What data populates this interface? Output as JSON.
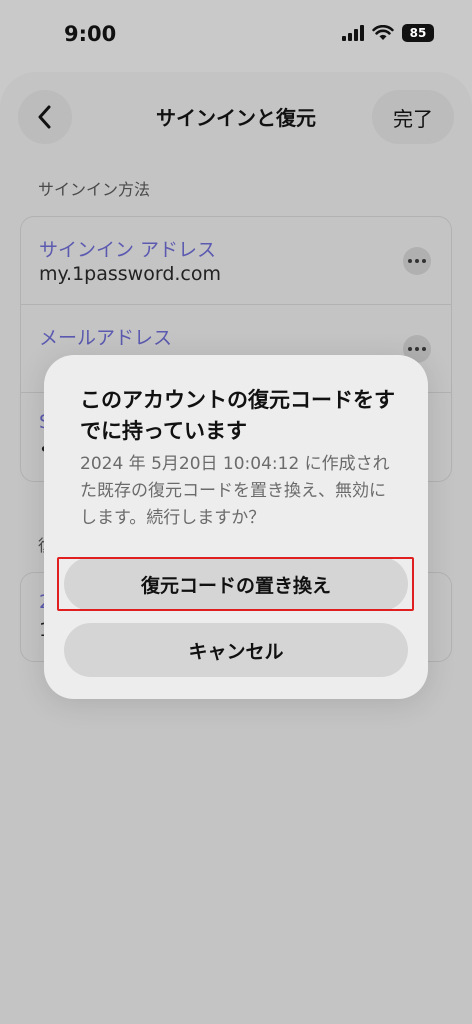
{
  "status_bar": {
    "time": "9:00",
    "battery": "85"
  },
  "nav": {
    "title": "サインインと復元",
    "done_label": "完了"
  },
  "section_signin": {
    "label": "サインイン方法",
    "rows": [
      {
        "label": "サインイン アドレス",
        "value": "my.1password.com"
      },
      {
        "label": "メールアドレス",
        "value": ""
      },
      {
        "label": "S",
        "value": "•"
      }
    ]
  },
  "section_recovery": {
    "label": "復",
    "rows": [
      {
        "label": "2",
        "value": "1"
      }
    ]
  },
  "dialog": {
    "title": "このアカウントの復元コードをすでに持っています",
    "message": "2024 年 5月20日 10:04:12 に作成された既存の復元コードを置き換え、無効にします。続行しますか？",
    "replace_label": "復元コードの置き換え",
    "cancel_label": "キャンセル"
  },
  "colors": {
    "link": "#5b5ab0",
    "highlight": "#e02020"
  }
}
